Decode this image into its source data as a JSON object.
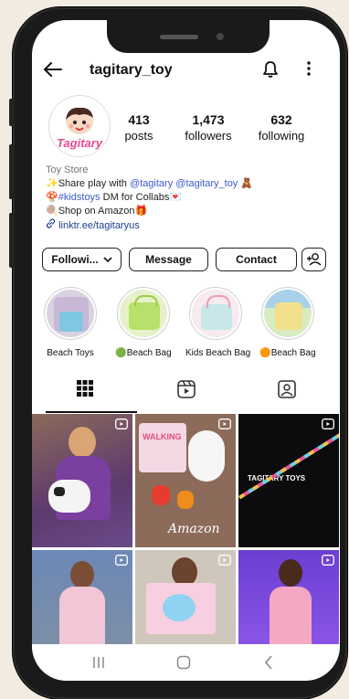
{
  "app": {
    "username": "tagitary_toy",
    "logo_text": "Tagitary"
  },
  "stats": [
    {
      "value": "413",
      "label": "posts"
    },
    {
      "value": "1,473",
      "label": "followers"
    },
    {
      "value": "632",
      "label": "following"
    }
  ],
  "bio": {
    "category": "Toy Store",
    "line1_prefix": "✨Share play with ",
    "line1_tag1": "@tagitary",
    "line1_tag2": "@tagitary_toy",
    "line1_suffix": " 🧸",
    "line2_prefix": "🍄",
    "line2_tag": "#kidstoys",
    "line2_suffix": " DM for Collabs💌",
    "line3": "🍭Shop on Amazon🎁",
    "link": "linktr.ee/tagitaryus"
  },
  "buttons": {
    "following": "Followi...",
    "message": "Message",
    "contact": "Contact"
  },
  "highlights": [
    {
      "label": "Beach Toys"
    },
    {
      "label": "🟢Beach Bag"
    },
    {
      "label": "Kids Beach Bag"
    },
    {
      "label": "🟠Beach Bag"
    }
  ],
  "grid_texts": {
    "amazon": "Amazon",
    "walking": "WALKING",
    "tagitary_toys": "TAGITARY TOYS"
  },
  "colors": {
    "accent_link": "#3b5bcc",
    "background": "#f1ebe1",
    "phone_frame": "#1a1a1a"
  },
  "icons": [
    "back-arrow-icon",
    "bell-icon",
    "more-icon",
    "add-person-icon",
    "grid-icon",
    "reels-icon",
    "tagged-icon",
    "reel-icon"
  ]
}
